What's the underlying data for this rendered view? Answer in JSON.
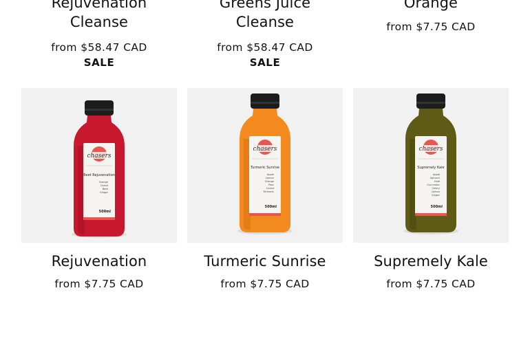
{
  "top_row": [
    {
      "title_lines": [
        "Rejuvenation",
        "Cleanse"
      ],
      "price_prefix": "from",
      "price": "$58.47 CAD",
      "badge": "SALE"
    },
    {
      "title_lines": [
        "Greens Juice",
        "Cleanse"
      ],
      "price_prefix": "from",
      "price": "$58.47 CAD",
      "badge": "SALE"
    },
    {
      "title_lines": [
        "Orange"
      ],
      "price_prefix": "from",
      "price": "$7.75 CAD"
    }
  ],
  "products": [
    {
      "title": "Rejuvenation",
      "price_prefix": "from",
      "price": "$7.75 CAD",
      "juice_color": "#c8182f",
      "juice_dark": "#9e0f22",
      "label_brand": "chasers",
      "label_name": "Beet Rejuvenation",
      "label_ingredients": [
        "Orange",
        "Carrot",
        "Beet",
        "Ginger"
      ],
      "label_volume": "500ml"
    },
    {
      "title": "Turmeric Sunrise",
      "price_prefix": "from",
      "price": "$7.75 CAD",
      "juice_color": "#f28a1e",
      "juice_dark": "#d46f10",
      "label_brand": "chasers",
      "label_name": "Turmeric Sunrise",
      "label_ingredients": [
        "Apple",
        "Lemon",
        "Orange",
        "Pear",
        "Carrot",
        "Turmeric"
      ],
      "label_volume": "500ml"
    },
    {
      "title": "Supremely Kale",
      "price_prefix": "from",
      "price": "$7.75 CAD",
      "juice_color": "#5f5a16",
      "juice_dark": "#47430f",
      "label_brand": "chasers",
      "label_name": "Supremely Kale",
      "label_ingredients": [
        "Apple",
        "Spinach",
        "Kale",
        "Cucumber",
        "Celery",
        "Lemon",
        "Ginger"
      ],
      "label_volume": "500ml"
    }
  ],
  "colors": {
    "text": "#111111",
    "image_bg": "#f1f1f1",
    "cap": "#1c1c1c",
    "label_accent": "#e8574f"
  }
}
